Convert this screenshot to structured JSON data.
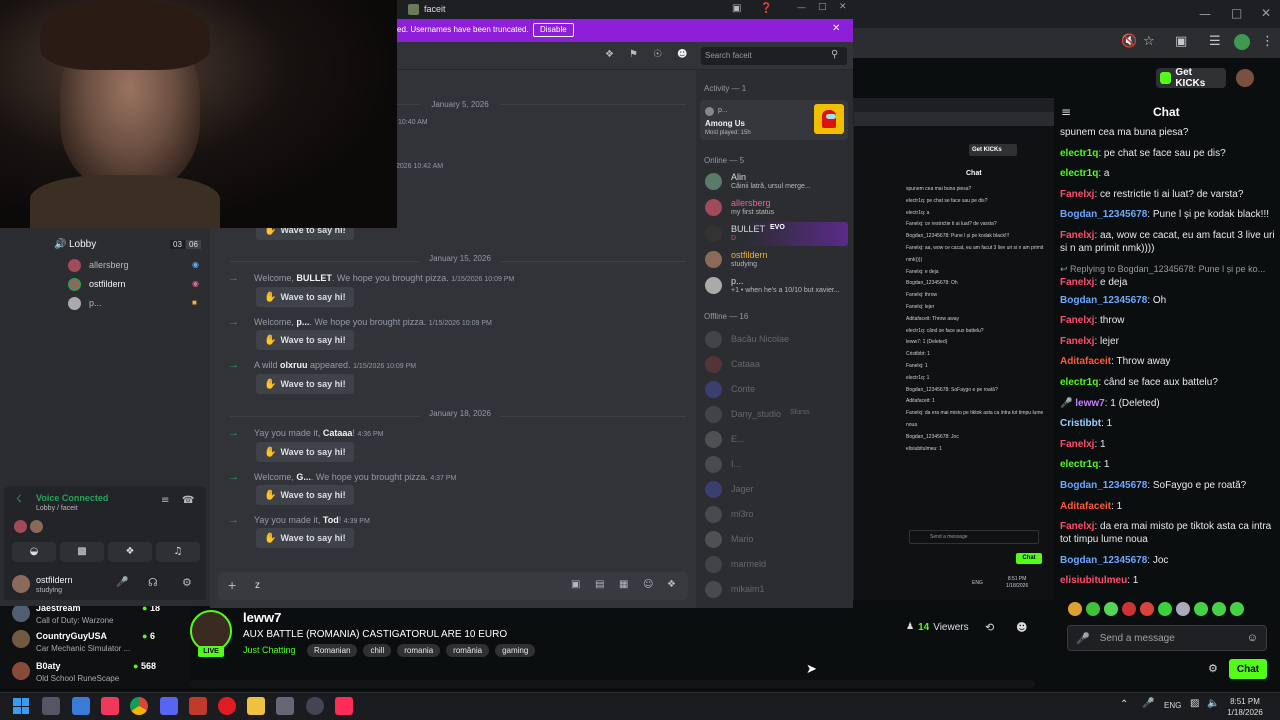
{
  "discord": {
    "window_title": "faceit",
    "notice_text": "ed. Usernames have been truncated.",
    "notice_button": "Disable",
    "search_placeholder": "Search faceit",
    "voice_channel": {
      "name": "Lobby",
      "count_current": "03",
      "count_max": "06",
      "users": [
        "allersberg",
        "ostfildern",
        "p..."
      ]
    },
    "voice_status": {
      "title": "Voice Connected",
      "subtitle": "Lobby / faceit"
    },
    "user_panel": {
      "name": "ostfildern",
      "status": "studying"
    },
    "messages": {
      "date1": "January 5, 2026",
      "time1": "10:40 AM",
      "time2": "2026 10:42 AM",
      "wave_label": "Wave to say hi!",
      "date2": "January 15, 2026",
      "m1": {
        "prefix": "Welcome, ",
        "user": "BULLET",
        "suffix": ". We hope you brought pizza.",
        "time": "1/15/2026 10:09 PM"
      },
      "m2": {
        "prefix": "Welcome, ",
        "user": "p...",
        "suffix": ". We hope you brought pizza.",
        "time": "1/15/2026 10:09 PM"
      },
      "m3": {
        "prefix": "A wild ",
        "user": "olxruu",
        "suffix": " appeared.",
        "time": "1/15/2026 10:09 PM"
      },
      "date3": "January 18, 2026",
      "m4": {
        "prefix": "Yay you made it, ",
        "user": "Cataaa",
        "suffix": "!",
        "time": "4:36 PM"
      },
      "m5": {
        "prefix": "Welcome, ",
        "user": "G...",
        "suffix": ". We hope you brought pizza.",
        "time": "4:37 PM"
      },
      "m6": {
        "prefix": "Yay you made it, ",
        "user": "Tod",
        "suffix": "!",
        "time": "4:39 PM"
      }
    },
    "composer_text": "z",
    "members": {
      "activity_header": "Activity — 1",
      "activity_user": "p...",
      "activity_game": "Among Us",
      "activity_sub": "Most played: 15h",
      "online_header": "Online — 5",
      "online": [
        {
          "name": "Alin",
          "sub": "Câinii latră, ursul merge..."
        },
        {
          "name": "allersberg",
          "sub": "my first status"
        },
        {
          "name": "BULLET",
          "sub": "D"
        },
        {
          "name": "ostfildern",
          "sub": "studying"
        },
        {
          "name": "p...",
          "sub": "+1 • when he's a 10/10 but xavier..."
        }
      ],
      "badge_evo": "EVO",
      "offline_header": "Offline — 16",
      "offline": [
        "Bacău Nicolae",
        "Cataaa",
        "Conte",
        "Dany_studio",
        "E...",
        "I...",
        "Jager",
        "mi3ro",
        "Mario",
        "marmeld",
        "mikaim1"
      ],
      "offline_extra": "Slurss"
    }
  },
  "kick": {
    "get_kicks": "Get KICKs",
    "chat_title": "Chat",
    "chat": [
      {
        "user": "",
        "text": "spunem cea ma buna piesa?",
        "color": "#ffffff"
      },
      {
        "user": "electr1q",
        "text": ": pe chat se face sau pe dis?",
        "color": "#53fc18"
      },
      {
        "user": "electr1q",
        "text": ": a",
        "color": "#53fc18"
      },
      {
        "user": "Fanelxj",
        "text": ": ce restrictie ti ai luat? de varsta?",
        "color": "#ff4d6d"
      },
      {
        "user": "Bogdan_12345678",
        "text": ": Pune l și pe kodak black!!!",
        "color": "#6ea8ff"
      },
      {
        "user": "Fanelxj",
        "text": ": aa, wow ce cacat, eu am facut 3 live uri si n am primit nmk))))",
        "color": "#ff4d6d"
      },
      {
        "user": "Fanelxj",
        "text": ": e deja",
        "color": "#ff4d6d",
        "reply": "Replying to Bogdan_12345678: Pune l și pe ko..."
      },
      {
        "user": "Bogdan_12345678",
        "text": ": Oh",
        "color": "#6ea8ff"
      },
      {
        "user": "Fanelxj",
        "text": ": throw",
        "color": "#ff4d6d"
      },
      {
        "user": "Fanelxj",
        "text": ": lejer",
        "color": "#ff4d6d"
      },
      {
        "user": "Aditafaceit",
        "text": ": Throw away",
        "color": "#ff5a3c"
      },
      {
        "user": "electr1q",
        "text": ": când se face aux battelu?",
        "color": "#53fc18"
      },
      {
        "user": "leww7",
        "text": ": 1 (Deleted)",
        "color": "#c77dff"
      },
      {
        "user": "Cristibbt",
        "text": ": 1",
        "color": "#9ad0ff"
      },
      {
        "user": "Fanelxj",
        "text": ": 1",
        "color": "#ff4d6d"
      },
      {
        "user": "electr1q",
        "text": ": 1",
        "color": "#53fc18"
      },
      {
        "user": "Bogdan_12345678",
        "text": ": SoFaygo e pe roată?",
        "color": "#6ea8ff"
      },
      {
        "user": "Aditafaceit",
        "text": ": 1",
        "color": "#ff5a3c"
      },
      {
        "user": "Fanelxj",
        "text": ": da era mai misto pe tiktok asta ca intra tot timpu lume noua",
        "color": "#ff4d6d"
      },
      {
        "user": "Bogdan_12345678",
        "text": ": Joc",
        "color": "#6ea8ff"
      },
      {
        "user": "elisiubitulmeu",
        "text": ": 1",
        "color": "#ff4d6d"
      }
    ],
    "send_placeholder": "Send a message",
    "chat_button": "Chat",
    "stream": {
      "channel": "leww7",
      "title": "AUX BATTLE (ROMANIA) CASTIGATORUL ARE 10 EURO",
      "category": "Just Chatting",
      "tags": [
        "Romanian",
        "chill",
        "romania",
        "românia",
        "gaming"
      ],
      "live": "LIVE",
      "viewers": "14",
      "viewers_label": "Viewers"
    },
    "side_channels": [
      {
        "name": "Jaestream",
        "game": "Call of Duty: Warzone",
        "viewers": "18"
      },
      {
        "name": "CountryGuyUSA",
        "game": "Car Mechanic Simulator ...",
        "viewers": "6"
      },
      {
        "name": "B0aty",
        "game": "Old School RuneScape",
        "viewers": "568"
      }
    ]
  },
  "mini_chat": {
    "lines": [
      "spunem cea mai buna piesa?",
      "electr1q: pe chat se face sau pe dis?",
      "electr1q: a",
      "Fanelxj: ce restrictie ti ai luat? de varsta?",
      "Bogdan_12345678: Pune l și pe kodak black!!!",
      "Fanelxj: aa, wow ce cacat, eu am facut 3 live uri si n am primit nmk))))",
      "Fanelxj: e deja",
      "Bogdan_12345678: Oh",
      "Fanelxj: throw",
      "Fanelxj: lejer",
      "Aditafaceit: Throw away",
      "electr1q: când se face aux battelu?",
      "leww7: 1 (Deleted)",
      "Cristibbt: 1",
      "Fanelxj: 1",
      "electr1q: 1",
      "Bogdan_12345678: SoFaygo e pe roată?",
      "Aditafaceit: 1",
      "Fanelxj: da era mai misto pe tiktok asta ca intra tot timpu lume noua",
      "Bogdan_12345678: Joc",
      "elisiubitulmeu: 1"
    ],
    "send_placeholder": "Send a message",
    "chat_button": "Chat",
    "get_kicks": "Get KICKs",
    "title": "Chat",
    "clock_time": "8:51 PM",
    "clock_date": "1/18/2026",
    "lang": "ENG"
  },
  "taskbar": {
    "lang": "ENG",
    "time": "8:51 PM",
    "date": "1/18/2026"
  }
}
